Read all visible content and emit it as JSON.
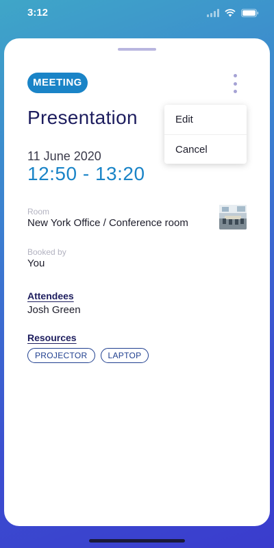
{
  "status_bar": {
    "time": "3:12",
    "icons": [
      "signal-icon",
      "wifi-icon",
      "battery-icon"
    ]
  },
  "event": {
    "type_badge": "MEETING",
    "title": "Presentation",
    "date": "11 June 2020",
    "time_range": "12:50 - 13:20",
    "room": {
      "label": "Room",
      "value": "New York Office / Conference room"
    },
    "booked_by": {
      "label": "Booked by",
      "value": "You"
    },
    "attendees": {
      "heading": "Attendees",
      "items": [
        "Josh Green"
      ]
    },
    "resources": {
      "heading": "Resources",
      "items": [
        "PROJECTOR",
        "LAPTOP"
      ]
    }
  },
  "menu": {
    "items": [
      "Edit",
      "Cancel"
    ]
  },
  "colors": {
    "accent": "#1a84c7",
    "title": "#1d1d5e",
    "chip_border": "#1d3d8e",
    "background_gradient": [
      "#3fa6c8",
      "#3a3ccd"
    ]
  }
}
